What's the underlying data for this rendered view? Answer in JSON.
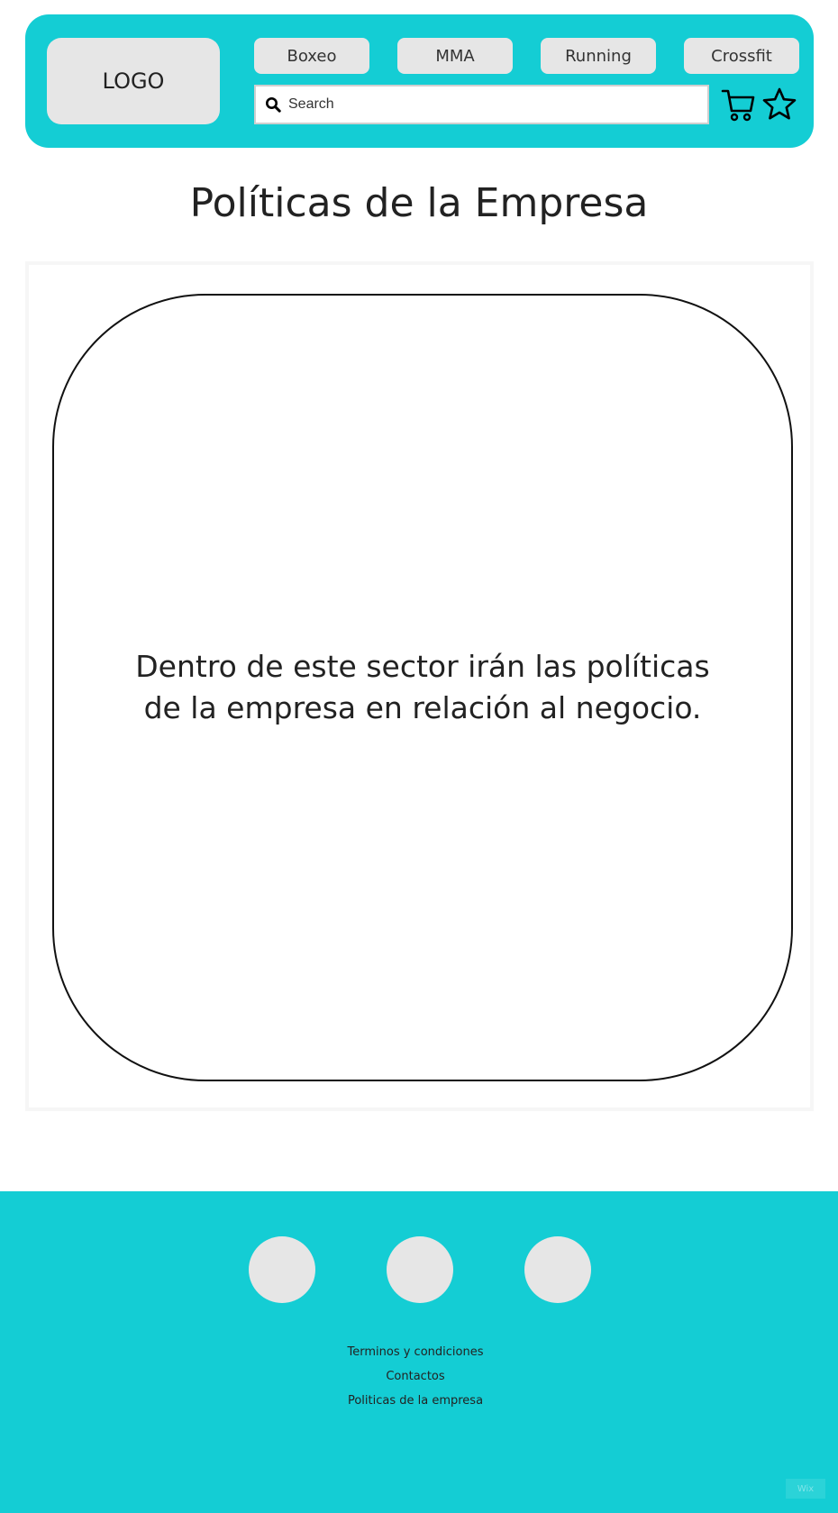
{
  "header": {
    "logo_text": "LOGO",
    "nav": [
      {
        "label": "Boxeo"
      },
      {
        "label": "MMA"
      },
      {
        "label": "Running"
      },
      {
        "label": "Crossfit"
      }
    ],
    "search": {
      "placeholder": "Search",
      "value": ""
    },
    "icons": [
      "search-icon",
      "cart-icon",
      "star-icon"
    ]
  },
  "main": {
    "title": "Políticas de la Empresa",
    "policy_text": "Dentro de este sector irán las políticas de la empresa en relación al negocio."
  },
  "footer": {
    "social_count": 3,
    "links": [
      {
        "label": "Terminos y condiciones"
      },
      {
        "label": "Contactos"
      },
      {
        "label": "Politicas de la empresa"
      }
    ],
    "badge": "Wix"
  },
  "colors": {
    "accent": "#14cdd4",
    "placeholder_gray": "#e6e6e6",
    "text": "#222222"
  }
}
